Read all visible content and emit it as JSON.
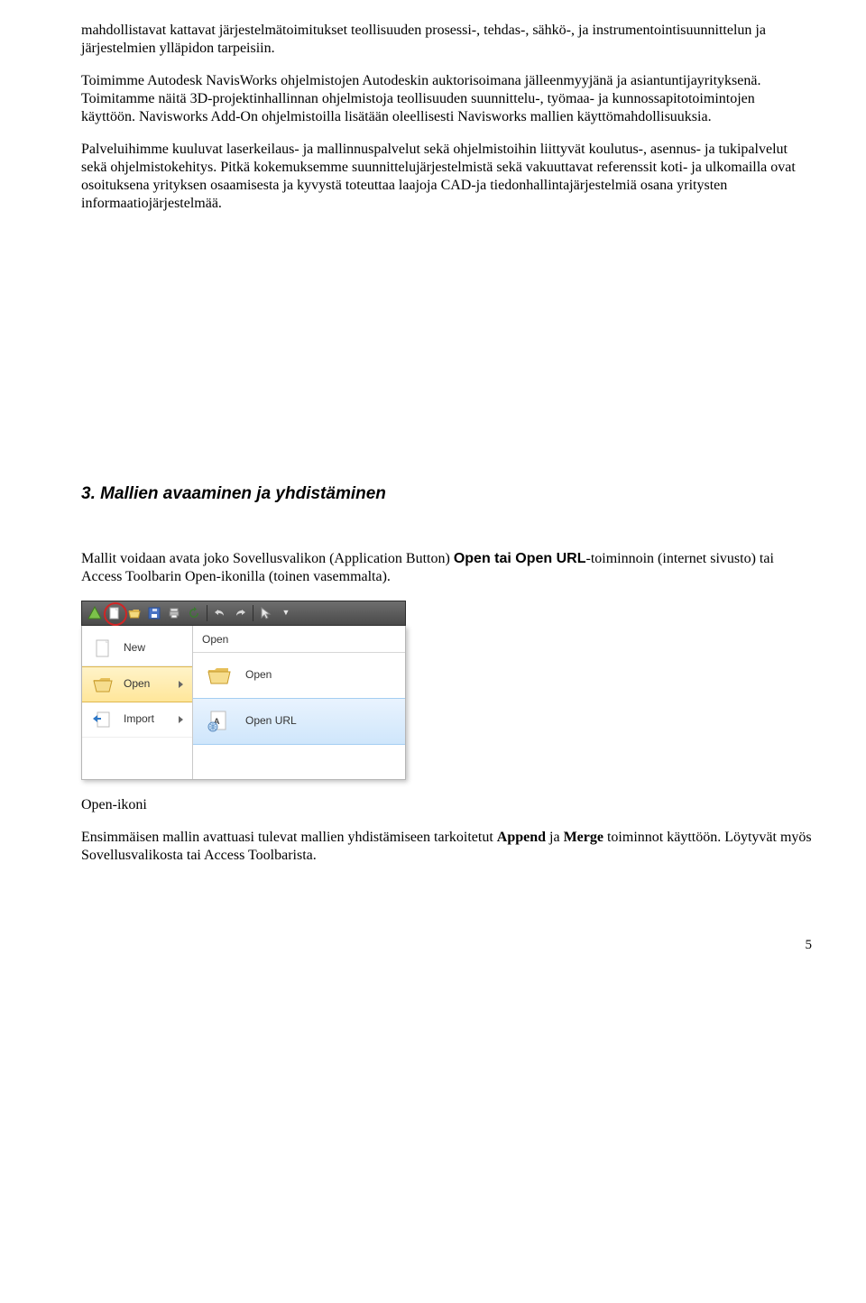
{
  "paragraphs": {
    "p1": "mahdollistavat kattavat järjestelmätoimitukset teollisuuden prosessi-, tehdas-, sähkö-, ja instrumentointisuunnittelun ja järjestelmien ylläpidon tarpeisiin.",
    "p2": "Toimimme Autodesk NavisWorks ohjelmistojen Autodeskin auktorisoimana jälleenmyyjänä ja asiantuntijayrityksenä. Toimitamme näitä 3D-projektinhallinnan ohjelmistoja teollisuuden suunnittelu-, työmaa- ja kunnossapitotoimintojen käyttöön. Navisworks Add-On ohjelmistoilla lisätään oleellisesti Navisworks mallien käyttömahdollisuuksia.",
    "p3": "Palveluihimme kuuluvat laserkeilaus- ja mallinnuspalvelut sekä ohjelmistoihin liittyvät koulutus-, asennus- ja tukipalvelut sekä ohjelmistokehitys. Pitkä kokemuksemme suunnittelujärjestelmistä sekä vakuuttavat referenssit koti- ja ulkomailla ovat osoituksena yrityksen osaamisesta ja kyvystä toteuttaa laajoja CAD-ja tiedonhallintajärjestelmiä osana yritysten informaatiojärjestelmää."
  },
  "section_heading": "3. Mallien avaaminen ja yhdistäminen",
  "section3": {
    "intro_before": "Mallit voidaan avata joko Sovellusvalikon (Application Button) ",
    "bold1": "Open tai Open URL",
    "intro_after": "-toiminnoin (internet sivusto) tai Access Toolbarin Open-ikonilla (toinen vasemmalta).",
    "caption": "Open-ikoni",
    "outro_before": "Ensimmäisen mallin avattuasi tulevat mallien yhdistämiseen tarkoitetut ",
    "bold2": "Append",
    "outro_mid": " ja ",
    "bold3": "Merge",
    "outro_after": " toiminnot käyttöön. Löytyvät myös Sovellusvalikosta tai Access Toolbarista."
  },
  "ui": {
    "left": {
      "new": "New",
      "open": "Open",
      "import": "Import"
    },
    "right": {
      "header": "Open",
      "open": "Open",
      "open_url": "Open URL"
    }
  },
  "page_number": "5"
}
